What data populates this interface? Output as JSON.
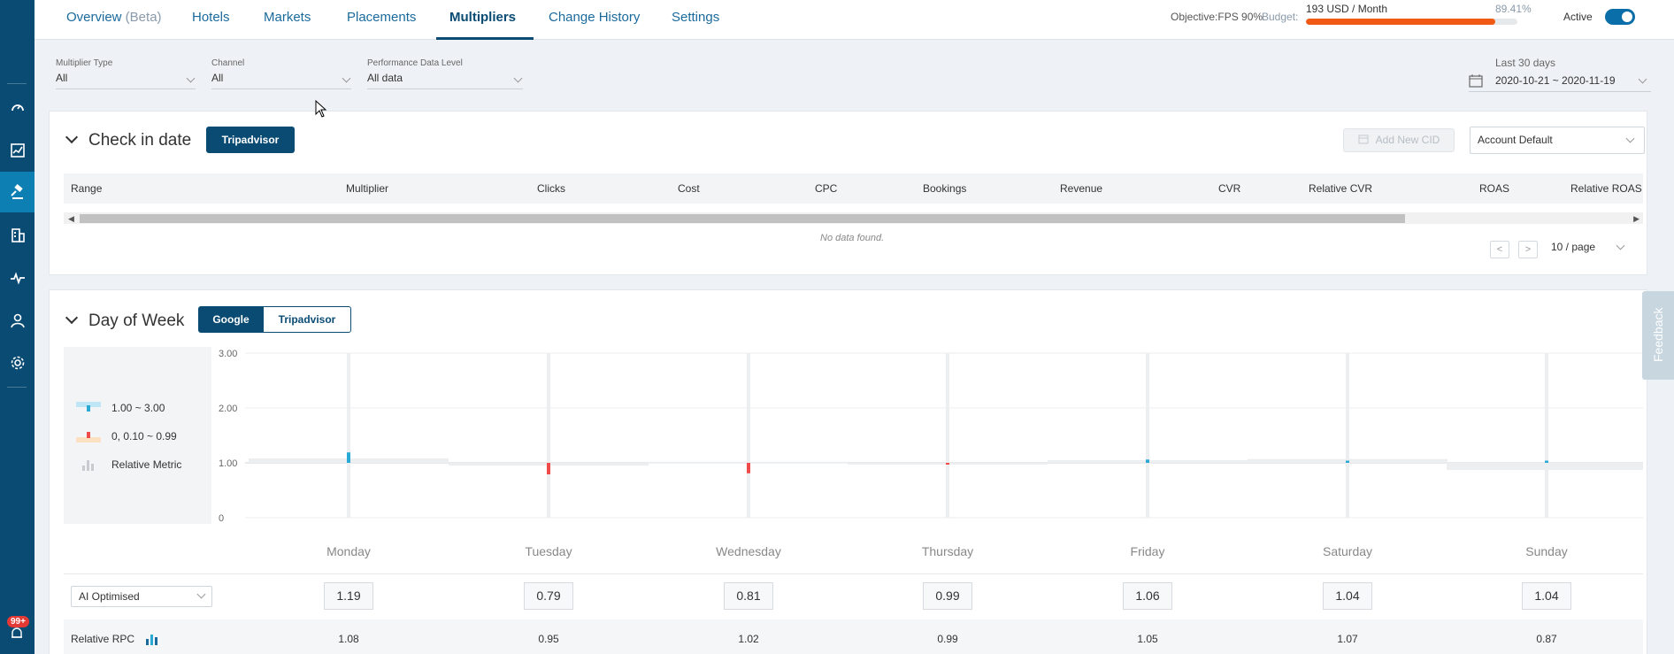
{
  "nav": {
    "tabs": [
      {
        "label": "Overview",
        "suffix": " (Beta)"
      },
      {
        "label": "Hotels"
      },
      {
        "label": "Markets"
      },
      {
        "label": "Placements"
      },
      {
        "label": "Multipliers"
      },
      {
        "label": "Change History"
      },
      {
        "label": "Settings"
      }
    ],
    "active_tab": "Multipliers",
    "objective_label": "Objective:",
    "objective_value": "FPS 90%",
    "budget_label": "Budget:",
    "budget_text": "193 USD / Month",
    "budget_percent_text": "89.41%",
    "budget_fraction": 0.8941,
    "active_label": "Active",
    "active_on": true
  },
  "filters": {
    "multiplier_type": {
      "label": "Multiplier Type",
      "value": "All"
    },
    "channel": {
      "label": "Channel",
      "value": "All"
    },
    "performance_level": {
      "label": "Performance Data Level",
      "value": "All data"
    },
    "date_caption": "Last 30 days",
    "date_range": "2020-10-21 ~ 2020-11-19"
  },
  "checkin": {
    "title": "Check in date",
    "channel_button": "Tripadvisor",
    "add_button": "Add New CID",
    "account_select": "Account Default",
    "columns": [
      "Range",
      "Multiplier",
      "Clicks",
      "Cost",
      "CPC",
      "Bookings",
      "Revenue",
      "CVR",
      "Relative CVR",
      "ROAS",
      "Relative ROAS"
    ],
    "empty_text": "No data found.",
    "page_prev": "<",
    "page_next": ">",
    "page_size": "10 / page"
  },
  "dow": {
    "title": "Day of Week",
    "tabs": [
      "Google",
      "Tripadvisor"
    ],
    "active_tab": "Google",
    "legend": [
      {
        "label": "1.00 ~ 3.00",
        "color": "#29a9d6"
      },
      {
        "label": "0, 0.10 ~ 0.99",
        "color": "#ef4b4b"
      },
      {
        "label": "Relative Metric",
        "color": "#c8ccd0"
      }
    ],
    "mode_select": "AI Optimised",
    "rpc_label": "Relative RPC",
    "days": [
      {
        "name": "Monday",
        "multiplier": "1.19",
        "rpc": "1.08"
      },
      {
        "name": "Tuesday",
        "multiplier": "0.79",
        "rpc": "0.95"
      },
      {
        "name": "Wednesday",
        "multiplier": "0.81",
        "rpc": "1.02"
      },
      {
        "name": "Thursday",
        "multiplier": "0.99",
        "rpc": "0.99"
      },
      {
        "name": "Friday",
        "multiplier": "1.06",
        "rpc": "1.05"
      },
      {
        "name": "Saturday",
        "multiplier": "1.04",
        "rpc": "1.07"
      },
      {
        "name": "Sunday",
        "multiplier": "1.04",
        "rpc": "0.87"
      }
    ]
  },
  "chart_data": {
    "type": "bar",
    "categories": [
      "Monday",
      "Tuesday",
      "Wednesday",
      "Thursday",
      "Friday",
      "Saturday",
      "Sunday"
    ],
    "y_ticks": [
      "3.00",
      "2.00",
      "1.00",
      "0"
    ],
    "ylim": [
      0,
      3
    ],
    "baseline": 1.0,
    "series": [
      {
        "values": [
          1.19,
          0.79,
          0.81,
          0.99,
          1.06,
          1.04,
          1.04
        ]
      },
      {
        "values": [
          1.08,
          0.95,
          1.02,
          0.99,
          1.05,
          1.07,
          0.87
        ]
      }
    ]
  },
  "feedback_label": "Feedback",
  "notifications_badge": "99+"
}
